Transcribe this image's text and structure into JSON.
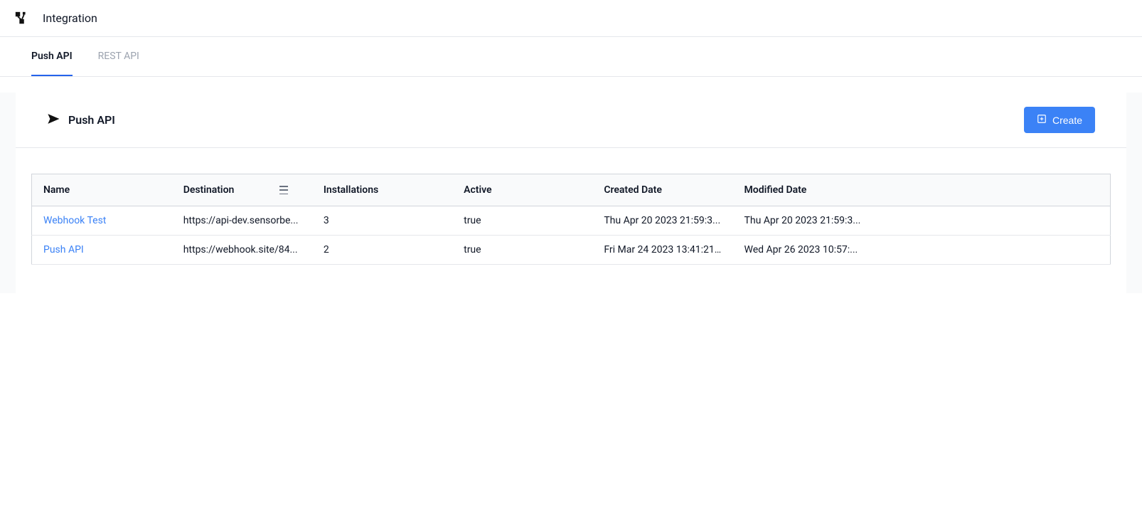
{
  "header": {
    "page_title": "Integration"
  },
  "tabs": [
    {
      "label": "Push API",
      "active": true
    },
    {
      "label": "REST API",
      "active": false
    }
  ],
  "section": {
    "title": "Push API",
    "create_label": "Create"
  },
  "table": {
    "columns": [
      {
        "label": "Name"
      },
      {
        "label": "Destination"
      },
      {
        "label": "Installations"
      },
      {
        "label": "Active"
      },
      {
        "label": "Created Date"
      },
      {
        "label": "Modified Date"
      }
    ],
    "rows": [
      {
        "name": "Webhook Test",
        "destination": "https://api-dev.sensorbe...",
        "installations": "3",
        "active": "true",
        "created": "Thu Apr 20 2023 21:59:3...",
        "modified": "Thu Apr 20 2023 21:59:3..."
      },
      {
        "name": "Push API",
        "destination": "https://webhook.site/84...",
        "installations": "2",
        "active": "true",
        "created": "Fri Mar 24 2023 13:41:21...",
        "modified": "Wed Apr 26 2023 10:57:..."
      }
    ]
  }
}
